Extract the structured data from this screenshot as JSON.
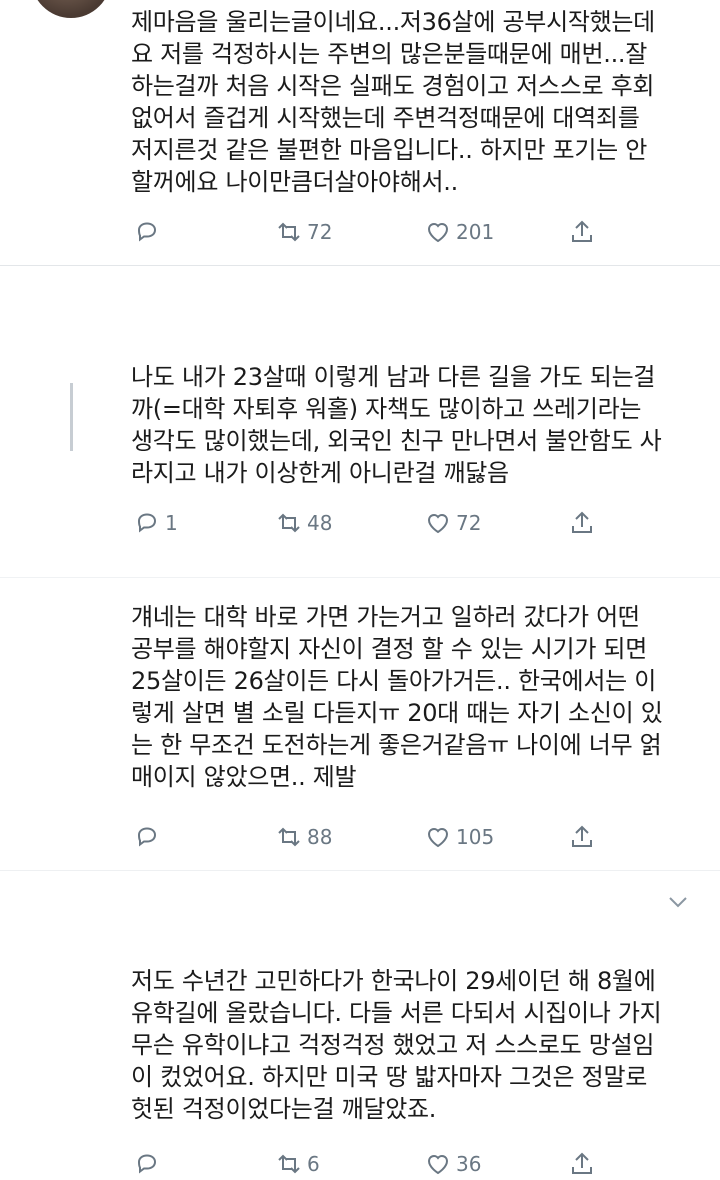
{
  "tweets": [
    {
      "text": "제마음을 울리는글이네요...저36살에 공부시작했는데\n요 저를 걱정하시는 주변의 많은분들때문에 매번...잘\n하는걸까 처음 시작은 실패도 경험이고  저스스로 후회\n없어서 즐겁게 시작했는데 주변걱정때문에 대역죄를\n저지른것 같은 불편한 마음입니다.. 하지만 포기는 안\n할꺼에요 나이만큼더살아야해서..",
      "reply_count": "",
      "retweet_count": "72",
      "like_count": "201"
    },
    {
      "text": "나도 내가 23살때 이렇게 남과 다른 길을 가도 되는걸\n까(=대학 자퇴후 워홀) 자책도 많이하고 쓰레기라는\n생각도 많이했는데, 외국인 친구 만나면서 불안함도 사\n라지고 내가 이상한게 아니란걸 깨닳음",
      "reply_count": "1",
      "retweet_count": "48",
      "like_count": "72"
    },
    {
      "text": "걔네는 대학 바로 가면 가는거고 일하러 갔다가 어떤\n공부를 해야할지 자신이 결정 할 수 있는 시기가 되면\n25살이든 26살이든 다시 돌아가거든.. 한국에서는 이\n렇게 살면 별 소릴 다듣지ㅠ 20대 때는 자기 소신이 있\n는 한 무조건 도전하는게 좋은거같음ㅠ 나이에 너무 얽\n매이지 않았으면.. 제발",
      "reply_count": "",
      "retweet_count": "88",
      "like_count": "105"
    },
    {
      "text": "저도 수년간 고민하다가 한국나이 29세이던 해 8월에\n유학길에 올랐습니다. 다들 서른 다되서 시집이나 가지\n무슨 유학이냐고 걱정걱정 했었고 저 스스로도 망설임\n이 컸었어요. 하지만 미국 땅 밟자마자 그것은 정말로\n헛된 걱정이었다는걸 깨달았죠.",
      "reply_count": "",
      "retweet_count": "6",
      "like_count": "36"
    }
  ],
  "icons": {
    "reply": "reply-icon",
    "retweet": "retweet-icon",
    "like": "like-icon",
    "share": "share-icon",
    "more": "chevron-down-icon"
  },
  "colors": {
    "text": "#1b1b1b",
    "action": "#6a7783",
    "divider": "#e3e6e9"
  }
}
